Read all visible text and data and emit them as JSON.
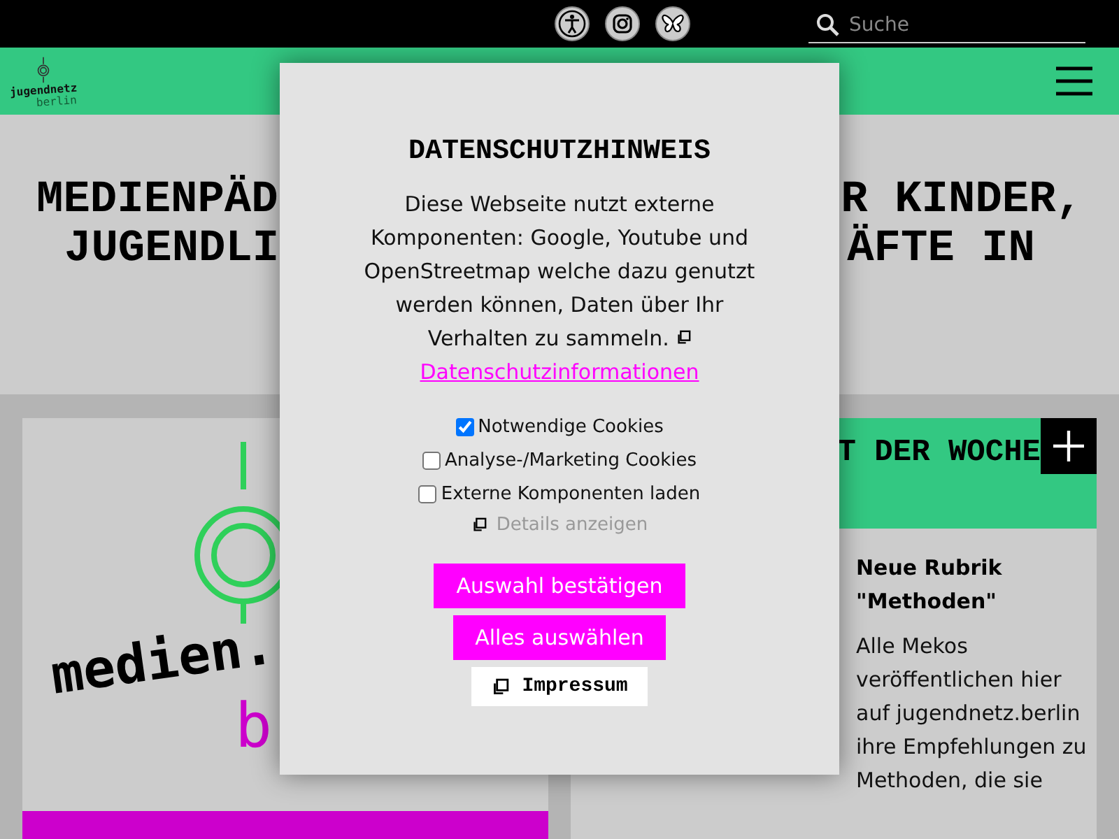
{
  "search": {
    "placeholder": "Suche"
  },
  "header": {
    "logo_lines": [
      "jugendnetz",
      "berlin"
    ]
  },
  "hero": {
    "lines": [
      {
        "left": "MEDIENPÄD",
        "right": "R KINDER,"
      },
      {
        "left": "JUGENDLI",
        "right": "ÄFTE IN"
      }
    ]
  },
  "left_card": {
    "logo_word": "medien.",
    "logo_letter": "b"
  },
  "right_card": {
    "heading": "T DER WOCHE",
    "title": "Neue Rubrik \"Methoden\"",
    "text": "Alle Mekos veröffentlichen hier auf jugendnetz.berlin ihre Empfehlungen zu Methoden, die sie"
  },
  "dialog": {
    "title": "DATENSCHUTZHINWEIS",
    "text": "Diese Webseite nutzt externe Komponenten: Google, Youtube und OpenStreetmap welche dazu genutzt werden können, Daten über Ihr Verhalten zu sammeln.",
    "link": "Datenschutzinformationen",
    "options": [
      {
        "label": "Notwendige Cookies",
        "checked": true
      },
      {
        "label": "Analyse-/Marketing Cookies",
        "checked": false
      },
      {
        "label": "Externe Komponenten laden",
        "checked": false
      }
    ],
    "details": "Details anzeigen",
    "buttons": [
      {
        "label": "Auswahl bestätigen",
        "kind": "primary"
      },
      {
        "label": "Alles auswählen",
        "kind": "primary"
      },
      {
        "label": "Impressum",
        "kind": "link"
      }
    ]
  }
}
